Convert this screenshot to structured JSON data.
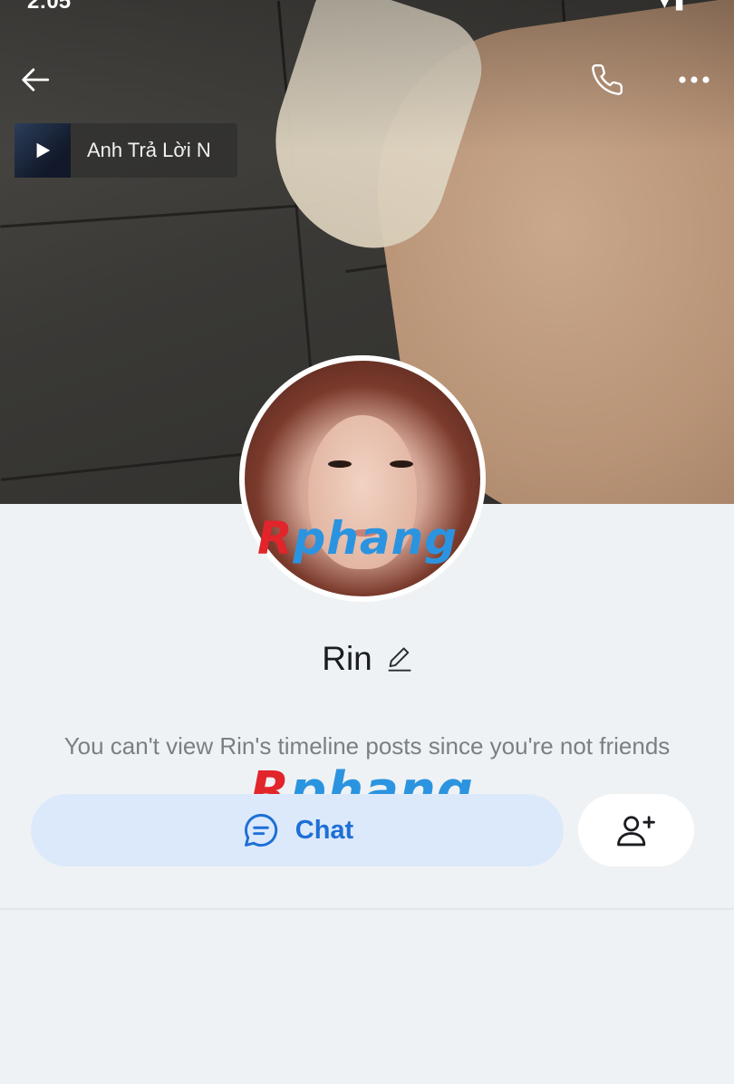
{
  "status_bar": {
    "time": "2:05"
  },
  "cover_music": {
    "title": "Anh Trả Lời N",
    "play_icon": "play-icon"
  },
  "top_actions": {
    "back_icon": "arrow-left-icon",
    "call_icon": "phone-icon",
    "more_icon": "more-horizontal-icon"
  },
  "profile": {
    "name": "Rin",
    "edit_icon": "pencil-icon",
    "notice": "You can't view Rin's timeline posts since you're not friends"
  },
  "actions": {
    "chat_label": "Chat",
    "chat_icon": "chat-bubble-icon",
    "add_friend_icon": "add-friend-icon",
    "chat_color": "#1e6fd6",
    "chat_bg": "#dce9fb"
  },
  "watermark": {
    "first": "R",
    "rest": "phang"
  }
}
